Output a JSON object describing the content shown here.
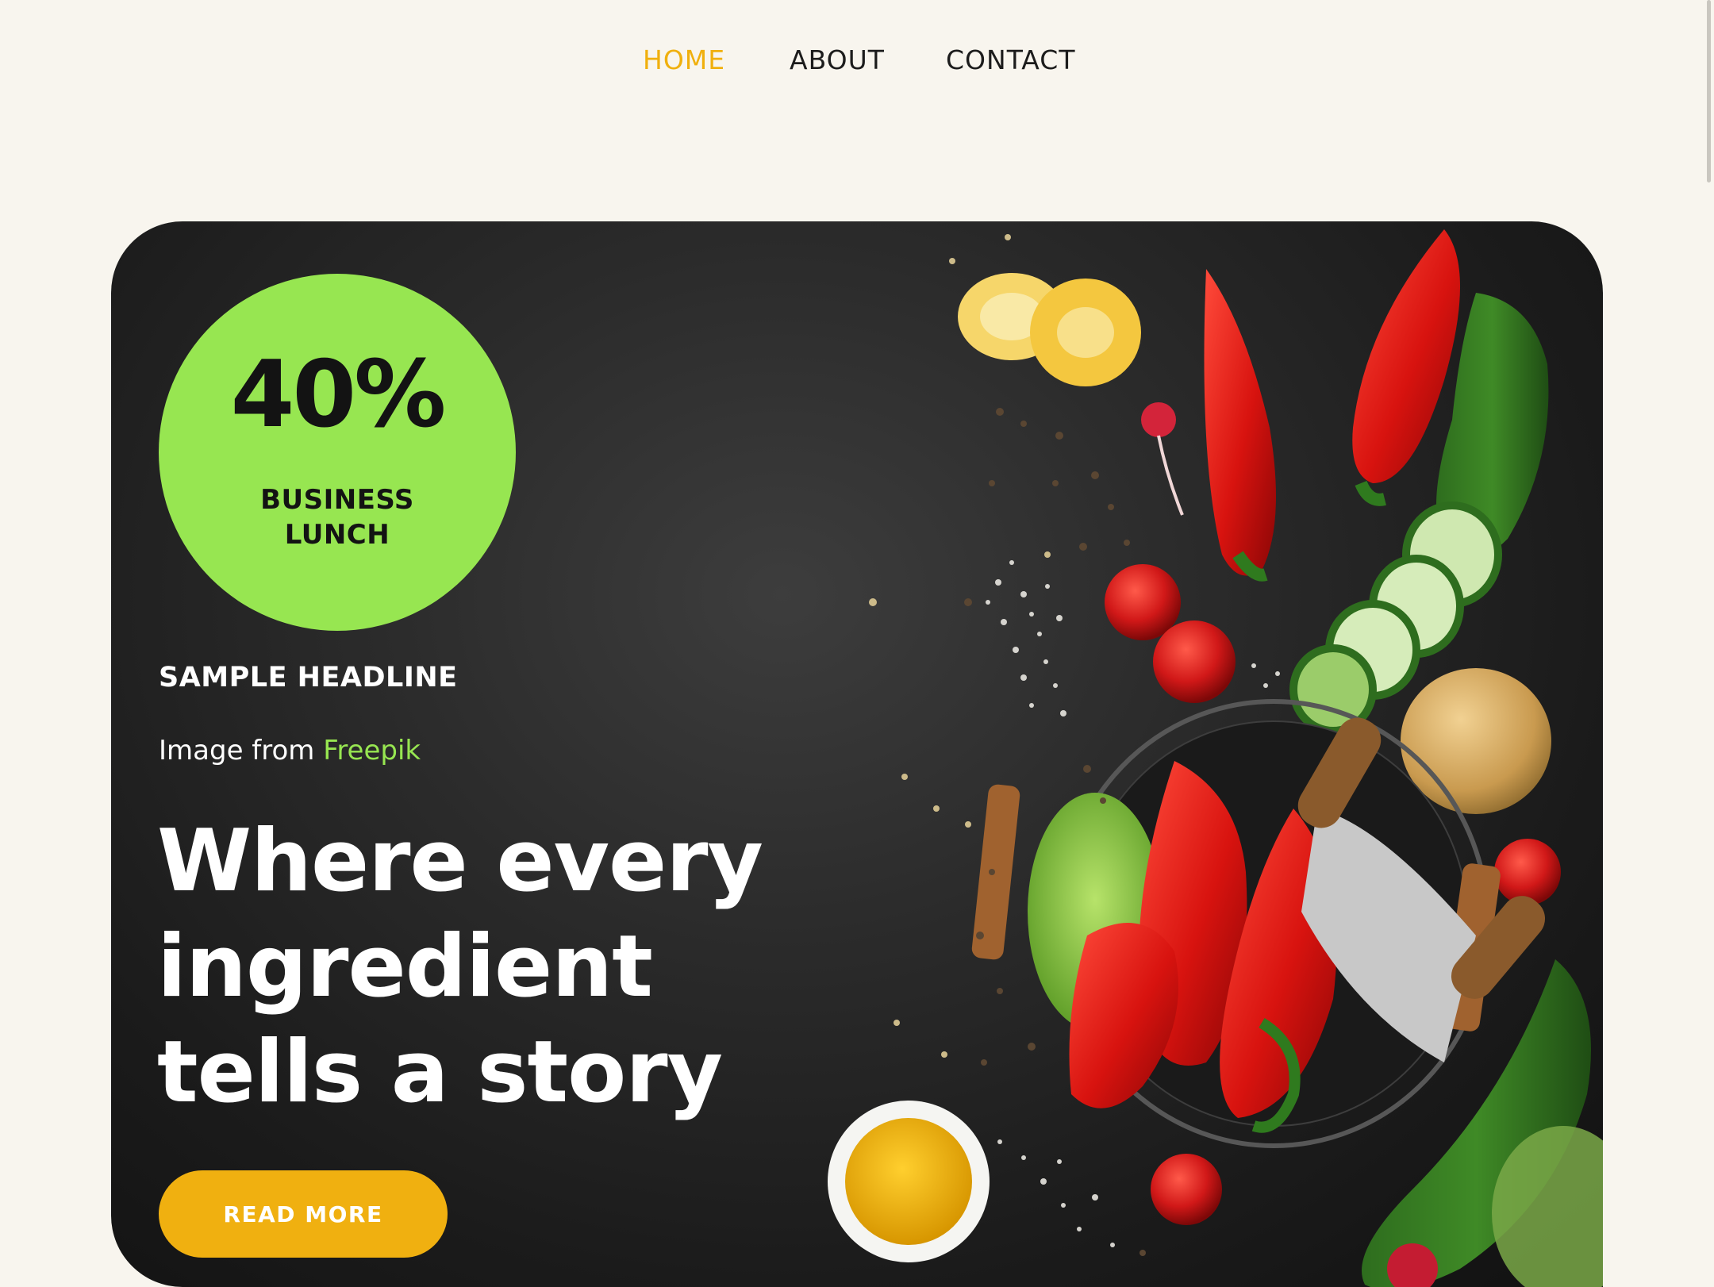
{
  "nav": {
    "items": [
      {
        "label": "HOME",
        "active": true
      },
      {
        "label": "ABOUT",
        "active": false
      },
      {
        "label": "CONTACT",
        "active": false
      }
    ]
  },
  "hero": {
    "badge": {
      "percent": "40%",
      "line1": "BUSINESS",
      "line2": "LUNCH"
    },
    "sample_headline": "SAMPLE HEADLINE",
    "credit": {
      "prefix": "Image from ",
      "link_text": "Freepik"
    },
    "headline": {
      "line1": "Where every",
      "line2": "ingredient",
      "line3": "tells a story"
    },
    "cta_label": "READ MORE"
  },
  "colors": {
    "page_background": "#f8f5ee",
    "nav_active": "#f0b00e",
    "badge_green": "#97e651",
    "cta_yellow": "#f0b010",
    "hero_dark": "#1b1b1b"
  },
  "icons": [
    "vegetables-photo"
  ]
}
